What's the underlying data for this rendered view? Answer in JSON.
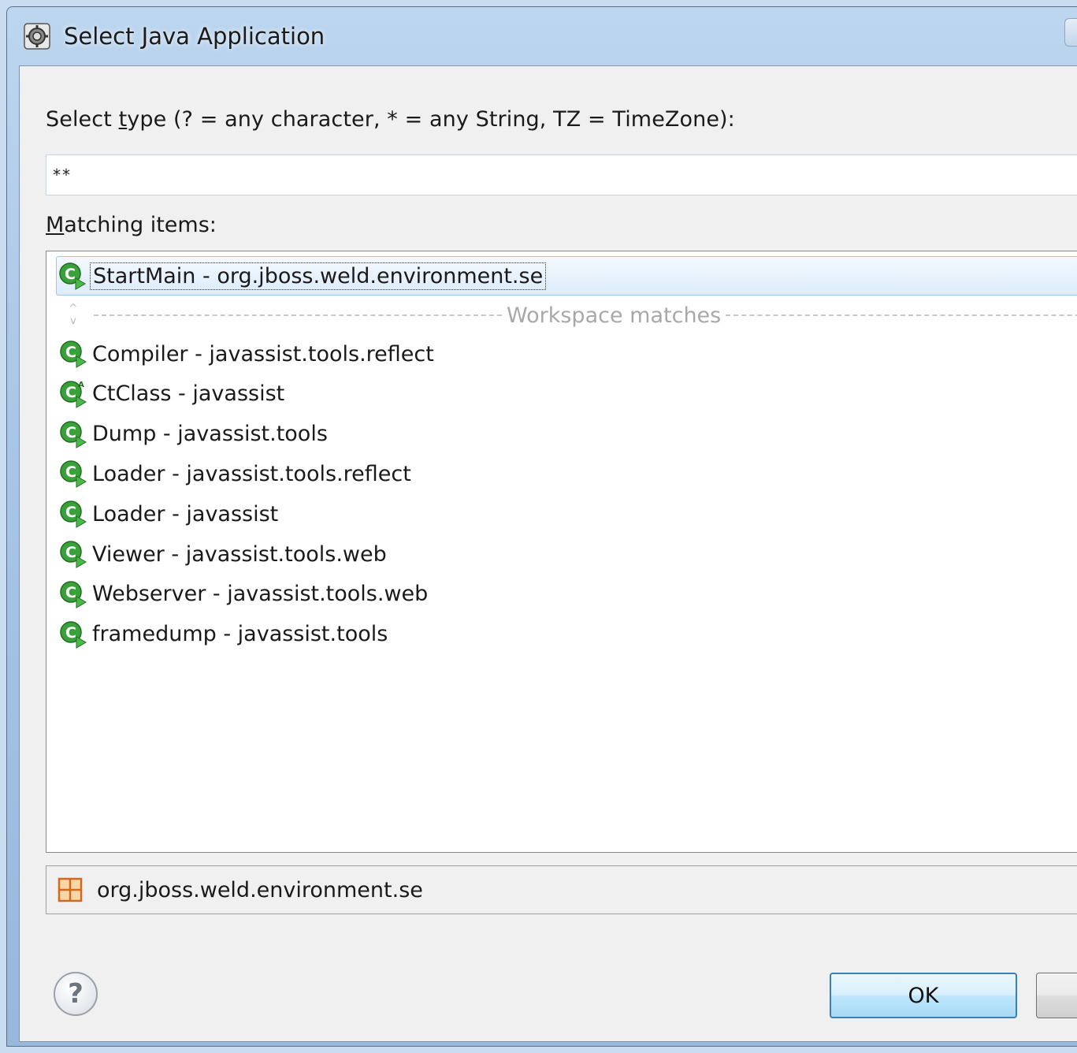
{
  "window": {
    "title": "Select Java Application",
    "title_icon": "gear-icon"
  },
  "prompt": {
    "label_prefix": "Select ",
    "label_mnemonic": "t",
    "label_suffix": "ype (? = any character, * = any String, TZ = TimeZone):"
  },
  "filter": {
    "value": "**"
  },
  "matching": {
    "label_mnemonic": "M",
    "label_rest": "atching items:"
  },
  "list": {
    "selected_item": "StartMain - org.jboss.weld.environment.se",
    "separator_label": "Workspace matches",
    "items": [
      {
        "text": "Compiler - javassist.tools.reflect",
        "icon": "main-class-icon"
      },
      {
        "text": "CtClass - javassist",
        "icon": "abstract-main-class-icon"
      },
      {
        "text": "Dump - javassist.tools",
        "icon": "main-class-icon"
      },
      {
        "text": "Loader - javassist.tools.reflect",
        "icon": "main-class-icon"
      },
      {
        "text": "Loader - javassist",
        "icon": "main-class-icon"
      },
      {
        "text": "Viewer - javassist.tools.web",
        "icon": "main-class-icon"
      },
      {
        "text": "Webserver - javassist.tools.web",
        "icon": "main-class-icon"
      },
      {
        "text": "framedump - javassist.tools",
        "icon": "main-class-icon"
      }
    ]
  },
  "details": {
    "package": "org.jboss.weld.environment.se",
    "icon": "package-icon"
  },
  "buttons": {
    "help": "?",
    "ok": "OK"
  },
  "colors": {
    "selection_bg": "#dcebfb",
    "selection_border": "#9cc6ee",
    "class_icon_green": "#3a9a3a",
    "package_icon_orange": "#e08a2a",
    "ok_border": "#3c7fb1"
  }
}
